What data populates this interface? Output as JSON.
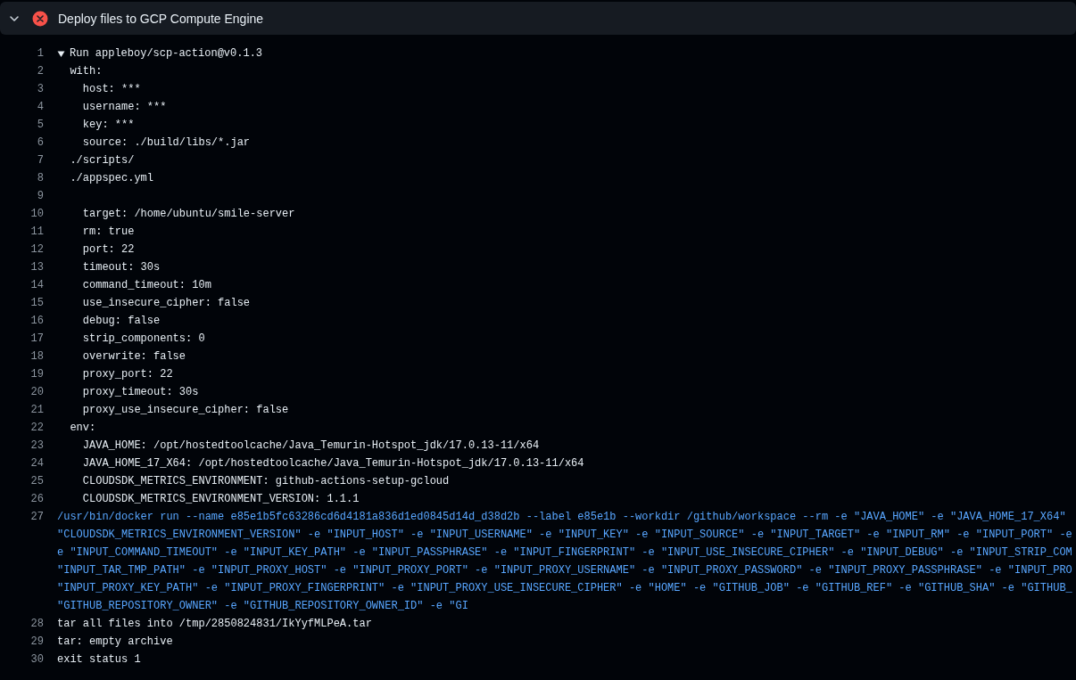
{
  "step": {
    "title": "Deploy files to GCP Compute Engine",
    "failed": true,
    "expanded": true
  },
  "log": [
    {
      "number": "1",
      "kind": "group",
      "expanded": true,
      "text": "Run appleboy/scp-action@v0.1.3"
    },
    {
      "number": "2",
      "kind": "plain",
      "text": "  with:"
    },
    {
      "number": "3",
      "kind": "plain",
      "text": "    host: ***"
    },
    {
      "number": "4",
      "kind": "plain",
      "text": "    username: ***"
    },
    {
      "number": "5",
      "kind": "plain",
      "text": "    key: ***"
    },
    {
      "number": "6",
      "kind": "plain",
      "text": "    source: ./build/libs/*.jar"
    },
    {
      "number": "7",
      "kind": "plain",
      "text": "  ./scripts/"
    },
    {
      "number": "8",
      "kind": "plain",
      "text": "  ./appspec.yml"
    },
    {
      "number": "9",
      "kind": "plain"
    },
    {
      "number": "10",
      "kind": "plain",
      "text": "    target: /home/ubuntu/smile-server"
    },
    {
      "number": "11",
      "kind": "plain",
      "text": "    rm: true"
    },
    {
      "number": "12",
      "kind": "plain",
      "text": "    port: 22"
    },
    {
      "number": "13",
      "kind": "plain",
      "text": "    timeout: 30s"
    },
    {
      "number": "14",
      "kind": "plain",
      "text": "    command_timeout: 10m"
    },
    {
      "number": "15",
      "kind": "plain",
      "text": "    use_insecure_cipher: false"
    },
    {
      "number": "16",
      "kind": "plain",
      "text": "    debug: false"
    },
    {
      "number": "17",
      "kind": "plain",
      "text": "    strip_components: 0"
    },
    {
      "number": "18",
      "kind": "plain",
      "text": "    overwrite: false"
    },
    {
      "number": "19",
      "kind": "plain",
      "text": "    proxy_port: 22"
    },
    {
      "number": "20",
      "kind": "plain",
      "text": "    proxy_timeout: 30s"
    },
    {
      "number": "21",
      "kind": "plain",
      "text": "    proxy_use_insecure_cipher: false"
    },
    {
      "number": "22",
      "kind": "plain",
      "text": "  env:"
    },
    {
      "number": "23",
      "kind": "plain",
      "text": "    JAVA_HOME: /opt/hostedtoolcache/Java_Temurin-Hotspot_jdk/17.0.13-11/x64"
    },
    {
      "number": "24",
      "kind": "plain",
      "text": "    JAVA_HOME_17_X64: /opt/hostedtoolcache/Java_Temurin-Hotspot_jdk/17.0.13-11/x64"
    },
    {
      "number": "25",
      "kind": "plain",
      "text": "    CLOUDSDK_METRICS_ENVIRONMENT: github-actions-setup-gcloud"
    },
    {
      "number": "26",
      "kind": "plain",
      "text": "    CLOUDSDK_METRICS_ENVIRONMENT_VERSION: 1.1.1"
    },
    {
      "number": "27",
      "kind": "command",
      "rows": [
        "/usr/bin/docker run --name e85e1b5fc63286cd6d4181a836d1ed0845d14d_d38d2b --label e85e1b --workdir /github/workspace --rm -e \"JAVA_HOME\" -e \"JAVA_HOME_17_X64\"",
        "\"CLOUDSDK_METRICS_ENVIRONMENT_VERSION\" -e \"INPUT_HOST\" -e \"INPUT_USERNAME\" -e \"INPUT_KEY\" -e \"INPUT_SOURCE\" -e \"INPUT_TARGET\" -e \"INPUT_RM\" -e \"INPUT_PORT\" -e",
        "e \"INPUT_COMMAND_TIMEOUT\" -e \"INPUT_KEY_PATH\" -e \"INPUT_PASSPHRASE\" -e \"INPUT_FINGERPRINT\" -e \"INPUT_USE_INSECURE_CIPHER\" -e \"INPUT_DEBUG\" -e \"INPUT_STRIP_COM",
        "\"INPUT_TAR_TMP_PATH\" -e \"INPUT_PROXY_HOST\" -e \"INPUT_PROXY_PORT\" -e \"INPUT_PROXY_USERNAME\" -e \"INPUT_PROXY_PASSWORD\" -e \"INPUT_PROXY_PASSPHRASE\" -e \"INPUT_PRO",
        "\"INPUT_PROXY_KEY_PATH\" -e \"INPUT_PROXY_FINGERPRINT\" -e \"INPUT_PROXY_USE_INSECURE_CIPHER\" -e \"HOME\" -e \"GITHUB_JOB\" -e \"GITHUB_REF\" -e \"GITHUB_SHA\" -e \"GITHUB_",
        "\"GITHUB_REPOSITORY_OWNER\" -e \"GITHUB_REPOSITORY_OWNER_ID\" -e \"GI"
      ]
    },
    {
      "number": "28",
      "kind": "plain",
      "text": "tar all files into /tmp/2850824831/IkYyfMLPeA.tar"
    },
    {
      "number": "29",
      "kind": "plain",
      "text": "tar: empty archive"
    },
    {
      "number": "30",
      "kind": "plain",
      "text": "exit status 1"
    }
  ]
}
